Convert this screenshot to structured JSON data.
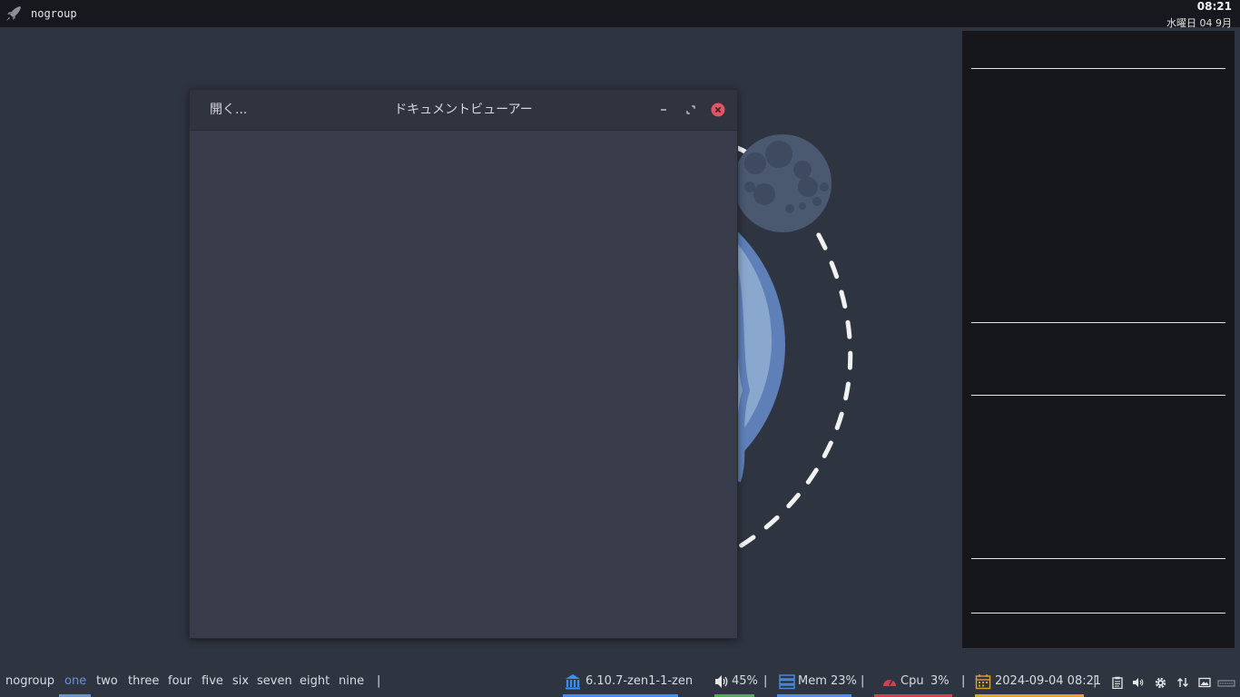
{
  "topbar": {
    "group_label": "nogroup",
    "time": "08:21",
    "date": "水曜日 04 9月",
    "launcher_icon": "rocket-icon"
  },
  "window": {
    "open_label": "開く...",
    "title": "ドキュメントビューアー",
    "buttons": [
      "minimize-icon",
      "maximize-icon",
      "close-icon"
    ],
    "close_color": "#e25563"
  },
  "bottombar": {
    "group_label": "nogroup",
    "workspaces": [
      "one",
      "two",
      "three",
      "four",
      "five",
      "six",
      "seven",
      "eight",
      "nine"
    ],
    "active_workspace": "one",
    "separator": "|",
    "kernel": "6.10.7-zen1-1-zen",
    "volume": "45%",
    "memory": "Mem 23%",
    "cpu_label": "Cpu",
    "cpu_value": "3%",
    "datetime": "2024-09-04 08:21",
    "colors": {
      "active_workspace": "#6f8fd6",
      "kernel": "#3f8ff0",
      "volume": "#4caf50",
      "memory": "#4a90e2",
      "cpu": "#d43f4e",
      "date": "#e0a030"
    },
    "tray_icons": [
      "clipboard-icon",
      "volume-icon",
      "settings-icon",
      "network-icon",
      "display-icon",
      "keyboard-icon"
    ]
  },
  "colors": {
    "background": "#2f3441",
    "panel": "#15171b",
    "window_body": "#373b4a"
  }
}
